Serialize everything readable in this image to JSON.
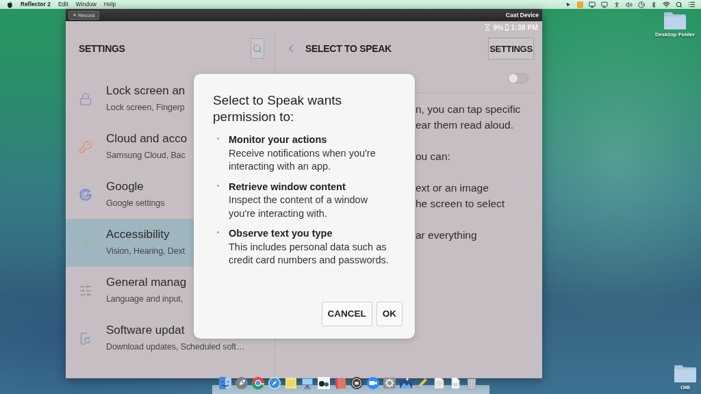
{
  "menu_bar": {
    "app_name": "Reflector 2",
    "menus": [
      "Edit",
      "Window",
      "Help"
    ]
  },
  "window": {
    "record_button": "Record",
    "title": "Cast Device"
  },
  "status_bar": {
    "battery": "9%",
    "time": "1:38 PM"
  },
  "sidebar": {
    "title": "SETTINGS",
    "items": [
      {
        "title": "Lock screen an",
        "subtitle": "Lock screen, Fingerp",
        "selected": false
      },
      {
        "title": "Cloud and acco",
        "subtitle": "Samsung Cloud, Bac",
        "selected": false
      },
      {
        "title": "Google",
        "subtitle": "Google settings",
        "selected": false
      },
      {
        "title": "Accessibility",
        "subtitle": "Vision, Hearing, Dext",
        "selected": true
      },
      {
        "title": "General manag",
        "subtitle": "Language and input,",
        "selected": false
      },
      {
        "title": "Software updat",
        "subtitle": "Download updates, Scheduled soft…",
        "selected": false
      }
    ]
  },
  "detail": {
    "title": "SELECT TO SPEAK",
    "settings_button": "SETTINGS",
    "toggle": {
      "on": false
    },
    "paragraphs": [
      [
        "n, you can tap specific",
        "ear them read aloud."
      ],
      [
        "ou can:"
      ],
      [
        "ext or an image",
        "he screen to select"
      ],
      [
        "ar everything"
      ]
    ]
  },
  "dialog": {
    "title": "Select to Speak wants permission to:",
    "permissions": [
      {
        "title": "Monitor your actions",
        "description": "Receive notifications when you're interacting with an app."
      },
      {
        "title": "Retrieve window content",
        "description": "Inspect the content of a window you're interacting with."
      },
      {
        "title": "Observe text you type",
        "description": "This includes personal data such as credit card numbers and passwords."
      }
    ],
    "buttons": [
      "CANCEL",
      "OK"
    ]
  },
  "desktop_icons": [
    {
      "label": "Desktop Folder"
    },
    {
      "label": "OIB"
    }
  ]
}
